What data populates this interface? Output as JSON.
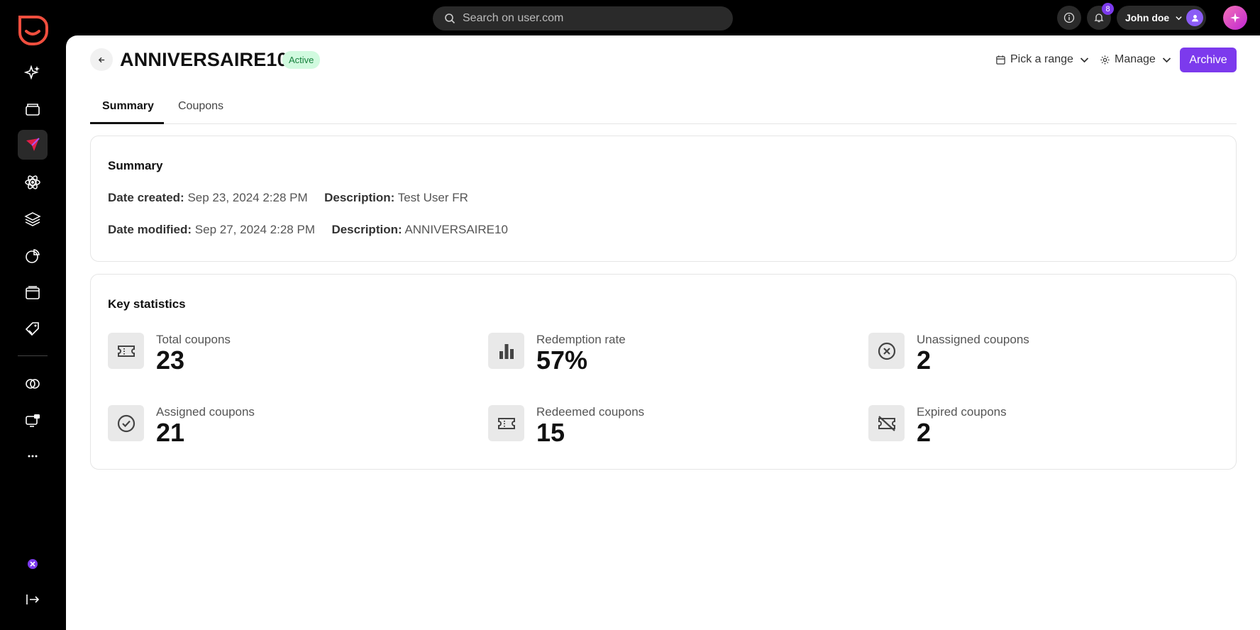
{
  "search": {
    "placeholder": "Search on user.com"
  },
  "topbar": {
    "notifications_count": "8",
    "user_name": "John doe"
  },
  "header": {
    "title": "ANNIVERSAIRE10",
    "status": "Active",
    "pick_range_label": "Pick a range",
    "manage_label": "Manage",
    "archive_label": "Archive"
  },
  "tabs": [
    {
      "label": "Summary",
      "active": true
    },
    {
      "label": "Coupons",
      "active": false
    }
  ],
  "summary": {
    "title": "Summary",
    "date_created_label": "Date created:",
    "date_created_value": "Sep 23, 2024 2:28 PM",
    "description1_label": "Description:",
    "description1_value": "Test User FR",
    "date_modified_label": "Date modified:",
    "date_modified_value": "Sep 27, 2024 2:28 PM",
    "description2_label": "Description:",
    "description2_value": "ANNIVERSAIRE10"
  },
  "key_statistics": {
    "title": "Key statistics",
    "items": [
      {
        "label": "Total coupons",
        "value": "23",
        "icon": "ticket-icon"
      },
      {
        "label": "Redemption rate",
        "value": "57%",
        "icon": "bar-chart-icon"
      },
      {
        "label": "Unassigned coupons",
        "value": "2",
        "icon": "x-circle-icon"
      },
      {
        "label": "Assigned coupons",
        "value": "21",
        "icon": "check-circle-icon"
      },
      {
        "label": "Redeemed coupons",
        "value": "15",
        "icon": "ticket-icon"
      },
      {
        "label": "Expired coupons",
        "value": "2",
        "icon": "ticket-off-icon"
      }
    ]
  },
  "colors": {
    "accent": "#7c3aed",
    "active_badge_bg": "#d1fadf",
    "active_badge_text": "#16803c",
    "brand": "#f04e3e"
  }
}
